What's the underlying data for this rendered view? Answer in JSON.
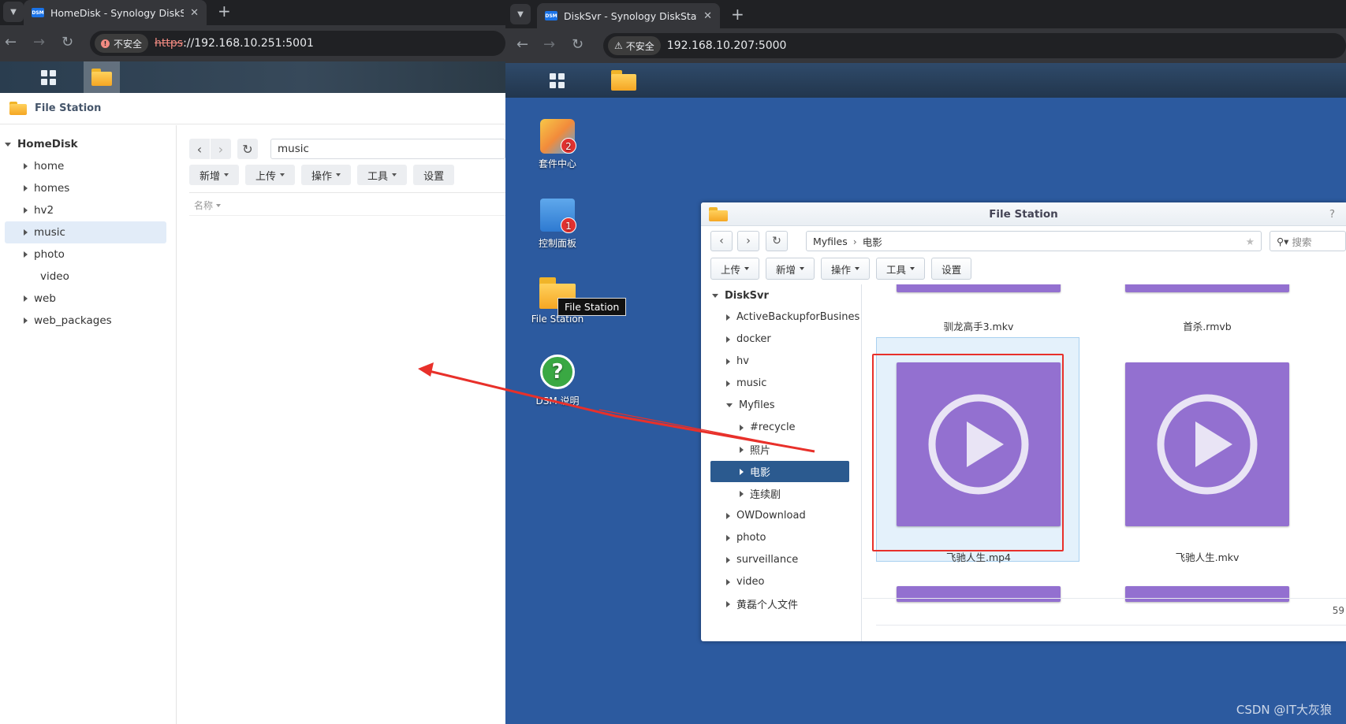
{
  "left_browser": {
    "tab_title": "HomeDisk - Synology DiskSt",
    "favicon": "DSM",
    "security_label": "不安全",
    "url_scheme": "https",
    "url_rest": "://192.168.10.251:5001"
  },
  "right_browser": {
    "tab_title": "DiskSvr - Synology DiskStatio",
    "favicon": "DSM",
    "security_label": "不安全",
    "url": "192.168.10.207:5000"
  },
  "left_fs": {
    "app_title": "File Station",
    "root": "HomeDisk",
    "folders": [
      "home",
      "homes",
      "hv2",
      "music",
      "photo",
      "video",
      "web",
      "web_packages"
    ],
    "selected_folder": "music",
    "path": "music",
    "toolbar": {
      "create": "新增",
      "upload": "上传",
      "action": "操作",
      "tools": "工具",
      "settings": "设置"
    },
    "column_name": "名称"
  },
  "desktop": {
    "icons": [
      {
        "label": "套件中心",
        "badge": "2"
      },
      {
        "label": "控制面板",
        "badge": "1"
      },
      {
        "label": "File Station"
      },
      {
        "label": "DSM 说明"
      }
    ],
    "tooltip": "File Station"
  },
  "right_fs": {
    "title": "File Station",
    "help": "?",
    "breadcrumb": [
      "Myfiles",
      "电影"
    ],
    "search_placeholder": "搜索",
    "toolbar": {
      "upload": "上传",
      "create": "新增",
      "action": "操作",
      "tools": "工具",
      "settings": "设置"
    },
    "root": "DiskSvr",
    "tree": [
      "ActiveBackupforBusines",
      "docker",
      "hv",
      "music",
      "Myfiles",
      "#recycle",
      "照片",
      "电影",
      "连续剧",
      "OWDownload",
      "photo",
      "surveillance",
      "video",
      "黄磊个人文件"
    ],
    "selected": "电影",
    "files": [
      "驯龙高手3.mkv",
      "首杀.rmvb",
      "飞驰人生.mp4",
      "飞驰人生.mkv"
    ],
    "count": "59"
  },
  "watermark": "CSDN @IT大灰狼",
  "colors": {
    "accent": "#2b5a8f",
    "video_thumb": "#9370d0",
    "annotation": "#e8302a",
    "desktop": "#2c5a9f"
  }
}
